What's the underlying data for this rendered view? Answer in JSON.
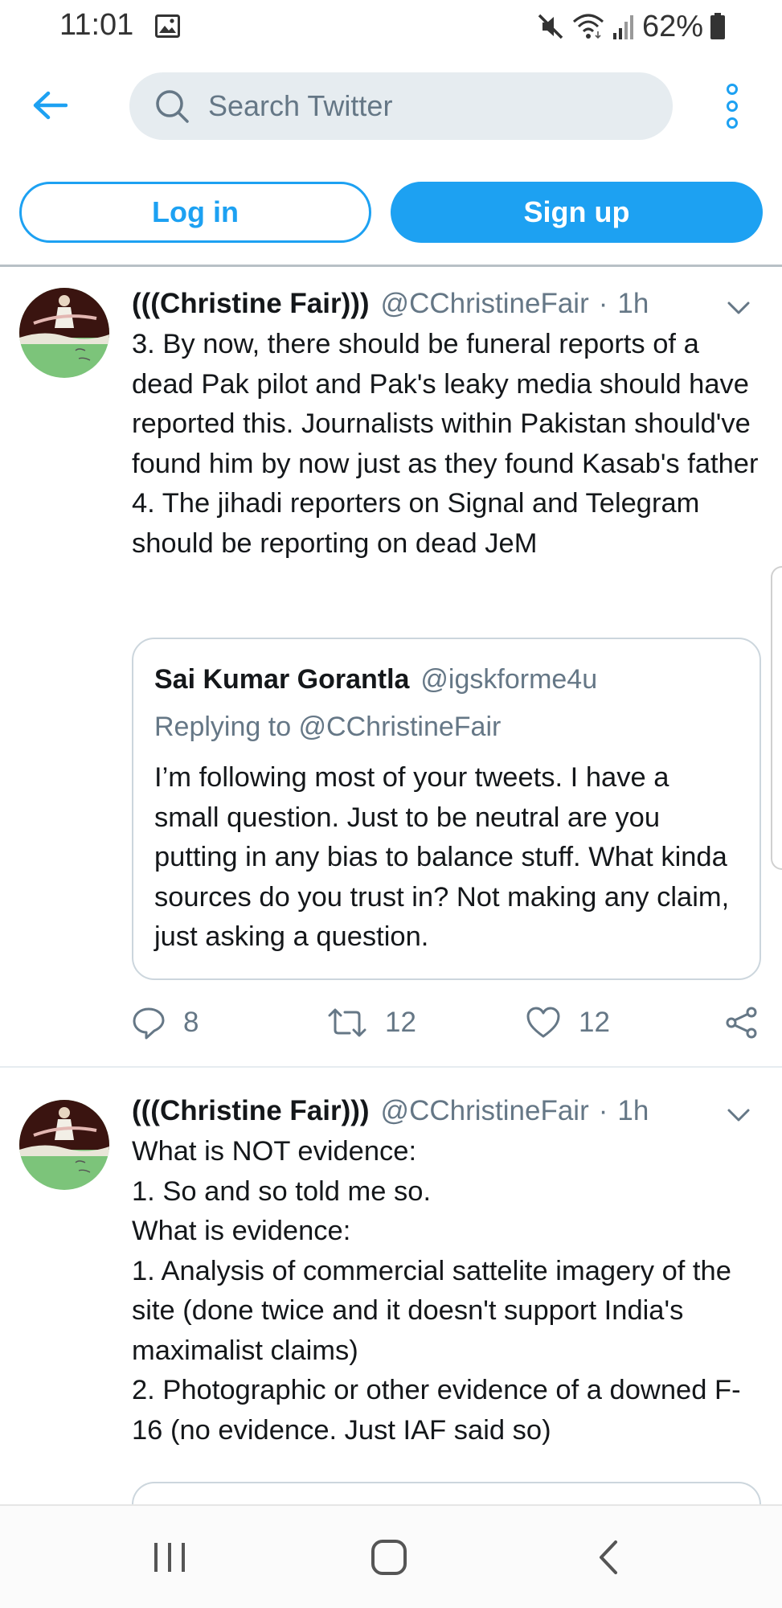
{
  "status_bar": {
    "time": "11:01",
    "battery": "62%"
  },
  "search": {
    "placeholder": "Search Twitter"
  },
  "auth": {
    "login_label": "Log in",
    "signup_label": "Sign up"
  },
  "tweets": [
    {
      "name": "(((Christine Fair)))",
      "handle": "@CChristineFair",
      "dot": "·",
      "time": "1h",
      "text": "3. By now, there should be funeral reports of a dead Pak pilot and Pak's leaky media should have reported this. Journalists within Pakistan should've found him by now just as they found Kasab's father\n4. The jihadi reporters on Signal and Telegram should be reporting on dead JeM",
      "quote": {
        "name": "Sai Kumar Gorantla",
        "handle": "@igskforme4u",
        "replying_to": "Replying to @CChristineFair",
        "text": "I’m following most of your tweets. I have a small question. Just to be neutral are you putting in any bias to balance stuff. What kinda sources do you trust in? Not making any claim, just asking a question."
      },
      "replies": "8",
      "retweets": "12",
      "likes": "12"
    },
    {
      "name": "(((Christine Fair)))",
      "handle": "@CChristineFair",
      "dot": "·",
      "time": "1h",
      "text": "What is NOT evidence:\n1. So and so told me so.\nWhat is evidence:\n1. Analysis of commercial sattelite imagery of the site (done twice and it doesn't support India's maximalist claims)\n2. Photographic or other evidence of a downed F-16 (no evidence. Just IAF said so)"
    }
  ],
  "icons": {
    "back": "arrow-left-icon",
    "search": "search-icon",
    "more": "more-vertical-icon",
    "caret": "chevron-down-icon",
    "reply": "reply-icon",
    "retweet": "retweet-icon",
    "like": "heart-icon",
    "share": "share-icon",
    "nav_recents": "recent-apps-icon",
    "nav_home": "home-icon",
    "nav_back": "nav-back-icon"
  },
  "colors": {
    "accent": "#1da1f2",
    "text": "#14171a",
    "secondary_text": "#657786",
    "search_bg": "#e6ecf0",
    "border": "#ccd6dd"
  }
}
